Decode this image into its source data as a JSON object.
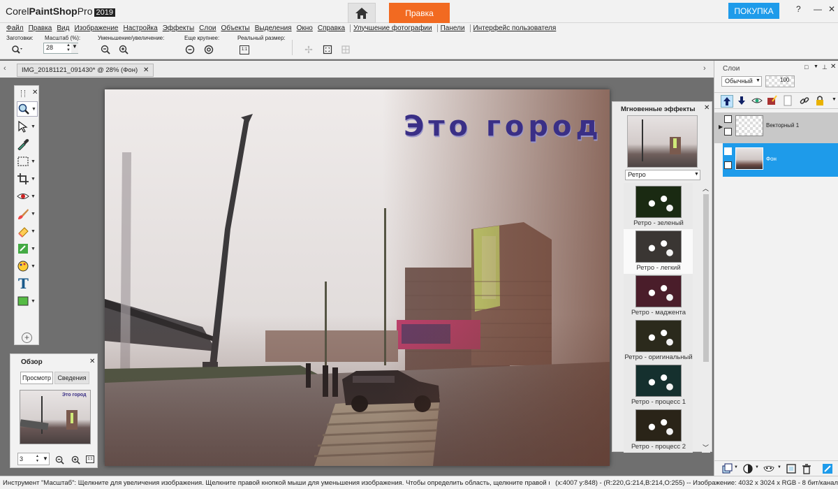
{
  "app": {
    "brand_a": "Corel",
    "brand_b": "PaintShop",
    "brand_c": "Pro",
    "year": "2019"
  },
  "header": {
    "tab_edit": "Правка",
    "buy": "ПОКУПКА"
  },
  "menu": [
    "Файл",
    "Правка",
    "Вид",
    "Изображение",
    "Настройка",
    "Эффекты",
    "Слои",
    "Объекты",
    "Выделения",
    "Окно",
    "Справка",
    "Улучшение фотографии",
    "Панели",
    "Интерфейс пользователя"
  ],
  "options": {
    "presets": "Заготовки:",
    "scale": "Масштаб (%):",
    "scale_value": "28",
    "zoom_inout": "Уменьшение/увеличение:",
    "bigger": "Еще крупнее:",
    "actual": "Реальный размер:",
    "actual_icon": "1:1"
  },
  "document": {
    "tab_title": "IMG_20181121_091430* @  28% (Фон)"
  },
  "canvas": {
    "title": "Это город"
  },
  "overview": {
    "title": "Обзор",
    "tab_preview": "Просмотр",
    "tab_info": "Сведения",
    "zoom_value": "3",
    "thumb_title": "Это город"
  },
  "effects": {
    "title": "Мгновенные эффекты",
    "category": "Ретро",
    "items": [
      "Ретро - зеленый",
      "Ретро - легкий",
      "Ретро - маджента",
      "Ретро - оригинальный",
      "Ретро - процесс 1",
      "Ретро - процесс 2"
    ]
  },
  "layers": {
    "title": "Слои",
    "blend_mode": "Обычный",
    "opacity": "100",
    "items": [
      "Векторный 1",
      "Фон"
    ]
  },
  "status": {
    "hint": "Инструмент \"Масштаб\": Щелкните для увеличения изображения. Щелкните правой кнопкой мыши для уменьшения изображения. Чтобы определить область, щелкните правой кнопкой мы...",
    "coords": "(x:4007 y:848) - (R:220,G:214,B:214,O:255) -- Изображение:  4032 x 3024 x RGB - 8 бит/канал"
  },
  "colors": {
    "accent": "#f26a21",
    "buy": "#1e9bea",
    "selection": "#1e9bea",
    "title_text": "#3a2f86"
  }
}
